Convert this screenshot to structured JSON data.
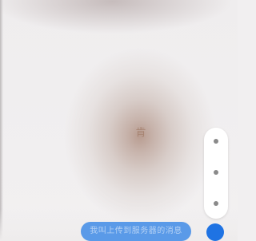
{
  "app": {
    "center_glyph": "肯"
  },
  "side_panel": {
    "items": [
      {
        "icon": "dot-icon"
      },
      {
        "icon": "dot-icon"
      },
      {
        "icon": "dot-icon"
      }
    ]
  },
  "prompt": {
    "text": "我叫上传到服务器的消息"
  },
  "colors": {
    "accent": "#1f73e3",
    "bubble": "#5a9ae8",
    "center_tone": "#b89c90"
  }
}
